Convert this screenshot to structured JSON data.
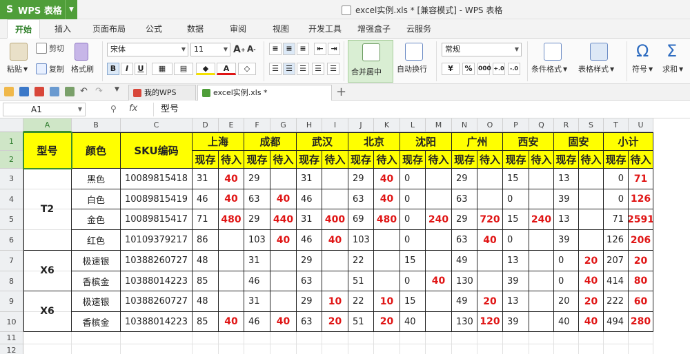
{
  "app": {
    "name": "WPS 表格",
    "logo": "S",
    "window_title": "excel实例.xls * [兼容模式] - WPS 表格",
    "accent": "#4f9e39"
  },
  "tabs": [
    "开始",
    "插入",
    "页面布局",
    "公式",
    "数据",
    "审阅",
    "视图",
    "开发工具",
    "增强盒子",
    "云服务"
  ],
  "ribbon": {
    "paste": "粘贴",
    "cut": "剪切",
    "copy": "复制",
    "format_painter": "格式刷",
    "font_name": "宋体",
    "font_size": "11",
    "bold": "B",
    "italic": "I",
    "underline": "U",
    "merge_center": "合并居中",
    "wrap_text": "自动换行",
    "number_format": "常规",
    "percent": "%",
    "conditional_format": "条件格式",
    "table_style": "表格样式",
    "symbol": "符号",
    "sum": "求和"
  },
  "doc_tabs": {
    "my_wps": "我的WPS",
    "file": "excel实例.xls *",
    "new_tab": "+"
  },
  "formula_bar": {
    "cell_ref": "A1",
    "fx": "fx",
    "value": "型号"
  },
  "sheet": {
    "columns": [
      "A",
      "B",
      "C",
      "D",
      "E",
      "F",
      "G",
      "H",
      "I",
      "J",
      "K",
      "L",
      "M",
      "N",
      "O",
      "P",
      "Q",
      "R",
      "S",
      "T",
      "U"
    ],
    "rows": [
      "1",
      "2",
      "3",
      "4",
      "5",
      "6",
      "7",
      "8",
      "9",
      "10",
      "11",
      "12"
    ],
    "header": {
      "model": "型号",
      "color": "颜色",
      "sku": "SKU编码",
      "cities": [
        "上海",
        "成都",
        "武汉",
        "北京",
        "沈阳",
        "广州",
        "西安",
        "固安",
        "小计"
      ],
      "stock": "现存",
      "incoming": "待入"
    },
    "groups": [
      "T2",
      "X6",
      "X6"
    ],
    "data_rows": [
      {
        "color": "黑色",
        "sku": "10089815418",
        "v": [
          "31",
          "40",
          "29",
          "",
          "31",
          "",
          "29",
          "40",
          "0",
          "",
          "29",
          "",
          "15",
          "",
          "13",
          "",
          "0",
          "71"
        ]
      },
      {
        "color": "白色",
        "sku": "10089815419",
        "v": [
          "46",
          "40",
          "63",
          "40",
          "46",
          "",
          "63",
          "40",
          "0",
          "",
          "63",
          "",
          "0",
          "",
          "39",
          "",
          "0",
          "126"
        ]
      },
      {
        "color": "金色",
        "sku": "10089815417",
        "v": [
          "71",
          "480",
          "29",
          "440",
          "31",
          "400",
          "69",
          "480",
          "0",
          "240",
          "29",
          "720",
          "15",
          "240",
          "13",
          "",
          "71",
          "2591"
        ]
      },
      {
        "color": "红色",
        "sku": "10109379217",
        "v": [
          "86",
          "",
          "103",
          "40",
          "46",
          "40",
          "103",
          "",
          "0",
          "",
          "63",
          "40",
          "0",
          "",
          "39",
          "",
          "126",
          "206"
        ]
      },
      {
        "color": "极速银",
        "sku": "10388260727",
        "v": [
          "48",
          "",
          "31",
          "",
          "29",
          "",
          "22",
          "",
          "15",
          "",
          "49",
          "",
          "13",
          "",
          "0",
          "20",
          "207",
          "20"
        ]
      },
      {
        "color": "香槟金",
        "sku": "10388014223",
        "v": [
          "85",
          "",
          "46",
          "",
          "63",
          "",
          "51",
          "",
          "0",
          "40",
          "130",
          "",
          "39",
          "",
          "0",
          "40",
          "414",
          "80"
        ]
      },
      {
        "color": "极速银",
        "sku": "10388260727",
        "v": [
          "48",
          "",
          "31",
          "",
          "29",
          "10",
          "22",
          "10",
          "15",
          "",
          "49",
          "20",
          "13",
          "",
          "20",
          "20",
          "222",
          "60"
        ]
      },
      {
        "color": "香槟金",
        "sku": "10388014223",
        "v": [
          "85",
          "40",
          "46",
          "40",
          "63",
          "20",
          "51",
          "20",
          "40",
          "",
          "130",
          "120",
          "39",
          "",
          "40",
          "40",
          "494",
          "280"
        ]
      }
    ]
  },
  "colors": {
    "header_fill": "#ffff00",
    "incoming_text": "#e01515",
    "selection": "#3a8f2d"
  }
}
